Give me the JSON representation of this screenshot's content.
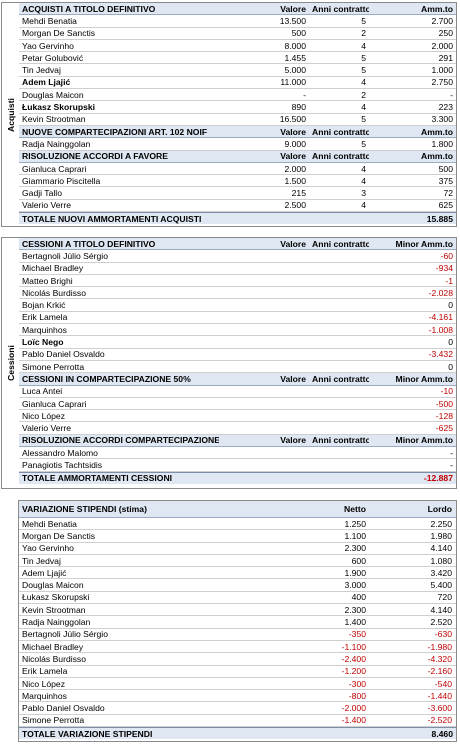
{
  "acquisti": {
    "side_label": "Acquisti",
    "sections": [
      {
        "header": [
          "ACQUISTI A TITOLO DEFINITIVO",
          "Valore",
          "Anni contratto",
          "Amm.to"
        ],
        "rows": [
          [
            "Mehdi Benatia",
            "13.500",
            "5",
            "2.700"
          ],
          [
            "Morgan De Sanctis",
            "500",
            "2",
            "250"
          ],
          [
            "Yao Gervinho",
            "8.000",
            "4",
            "2.000"
          ],
          [
            "Petar Golubović",
            "1.455",
            "5",
            "291"
          ],
          [
            "Tin Jedvaj",
            "5.000",
            "5",
            "1.000"
          ],
          [
            "Adem Ljajić",
            "11.000",
            "4",
            "2.750"
          ],
          [
            "Douglas Maicon",
            "-",
            "2",
            "-"
          ],
          [
            "Łukasz Skorupski",
            "890",
            "4",
            "223"
          ],
          [
            "Kevin Strootman",
            "16.500",
            "5",
            "3.300"
          ]
        ]
      },
      {
        "header": [
          "NUOVE COMPARTECIPAZIONI ART. 102 NOIF",
          "Valore",
          "Anni contratto",
          "Amm.to"
        ],
        "rows": [
          [
            "Radja Nainggolan",
            "9.000",
            "5",
            "1.800"
          ]
        ]
      },
      {
        "header": [
          "RISOLUZIONE ACCORDI A FAVORE",
          "Valore",
          "Anni contratto",
          "Amm.to"
        ],
        "rows": [
          [
            "Gianluca Caprari",
            "2.000",
            "4",
            "500"
          ],
          [
            "Giammario Piscitella",
            "1.500",
            "4",
            "375"
          ],
          [
            "Gadji Tallo",
            "215",
            "3",
            "72"
          ],
          [
            "Valerio Verre",
            "2.500",
            "4",
            "625"
          ]
        ]
      }
    ],
    "total": [
      "TOTALE NUOVI AMMORTAMENTI ACQUISTI",
      "15.885"
    ]
  },
  "cessioni": {
    "side_label": "Cessioni",
    "sections": [
      {
        "header": [
          "CESSIONI A TITOLO DEFINITIVO",
          "Valore",
          "Anni contratto",
          "Minor Amm.to"
        ],
        "rows": [
          [
            "Bertagnoli Júlio Sérgio",
            "",
            "",
            "-60"
          ],
          [
            "Michael Bradley",
            "",
            "",
            "-934"
          ],
          [
            "Matteo Brighi",
            "",
            "",
            "-1"
          ],
          [
            "Nicolás Burdisso",
            "",
            "",
            "-2.028"
          ],
          [
            "Bojan Krkić",
            "",
            "",
            "0"
          ],
          [
            "Erik Lamela",
            "",
            "",
            "-4.161"
          ],
          [
            "Marquinhos",
            "",
            "",
            "-1.008"
          ],
          [
            "Loïc Nego",
            "",
            "",
            "0"
          ],
          [
            "Pablo Daniel Osvaldo",
            "",
            "",
            "-3.432"
          ],
          [
            "Simone Perrotta",
            "",
            "",
            "0"
          ]
        ]
      },
      {
        "header": [
          "CESSIONI IN COMPARTECIPAZIONE 50%",
          "Valore",
          "Anni contratto",
          "Minor Amm.to"
        ],
        "rows": [
          [
            "Luca Antei",
            "",
            "",
            "-10"
          ],
          [
            "Gianluca Caprari",
            "",
            "",
            "-500"
          ],
          [
            "Nico López",
            "",
            "",
            "-128"
          ],
          [
            "Valerio Verre",
            "",
            "",
            "-625"
          ]
        ]
      },
      {
        "header": [
          "RISOLUZIONE ACCORDI COMPARTECIPAZIONE",
          "Valore",
          "Anni contratto",
          "Minor Amm.to"
        ],
        "rows": [
          [
            "Alessandro Malomo",
            "",
            "",
            "-"
          ],
          [
            "Panagiotis Tachtsidis",
            "",
            "",
            "-"
          ]
        ]
      }
    ],
    "total": [
      "TOTALE AMMORTAMENTI CESSIONI",
      "-12.887"
    ]
  },
  "stipendi": {
    "header": [
      "VARIAZIONE STIPENDI (stima)",
      "Netto",
      "Lordo"
    ],
    "rows": [
      [
        "Mehdi Benatia",
        "1.250",
        "2.250"
      ],
      [
        "Morgan De Sanctis",
        "1.100",
        "1.980"
      ],
      [
        "Yao Gervinho",
        "2.300",
        "4.140"
      ],
      [
        "Tin Jedvaj",
        "600",
        "1.080"
      ],
      [
        "Adem Ljajić",
        "1.900",
        "3.420"
      ],
      [
        "Douglas Maicon",
        "3.000",
        "5.400"
      ],
      [
        "Łukasz Skorupski",
        "400",
        "720"
      ],
      [
        "Kevin Strootman",
        "2.300",
        "4.140"
      ],
      [
        "Radja Nainggolan",
        "1.400",
        "2.520"
      ],
      [
        "Bertagnoli Júlio Sérgio",
        "-350",
        "-630"
      ],
      [
        "Michael Bradley",
        "-1.100",
        "-1.980"
      ],
      [
        "Nicolás Burdisso",
        "-2.400",
        "-4.320"
      ],
      [
        "Erik Lamela",
        "-1.200",
        "-2.160"
      ],
      [
        "Nico López",
        "-300",
        "-540"
      ],
      [
        "Marquinhos",
        "-800",
        "-1.440"
      ],
      [
        "Pablo Daniel Osvaldo",
        "-2.000",
        "-3.600"
      ],
      [
        "Simone Perrotta",
        "-1.400",
        "-2.520"
      ]
    ],
    "total": [
      "TOTALE VARIAZIONE STIPENDI",
      "8.460"
    ]
  },
  "colors": {
    "header_bg": "#dfe7f2",
    "negative": "#c00000"
  }
}
